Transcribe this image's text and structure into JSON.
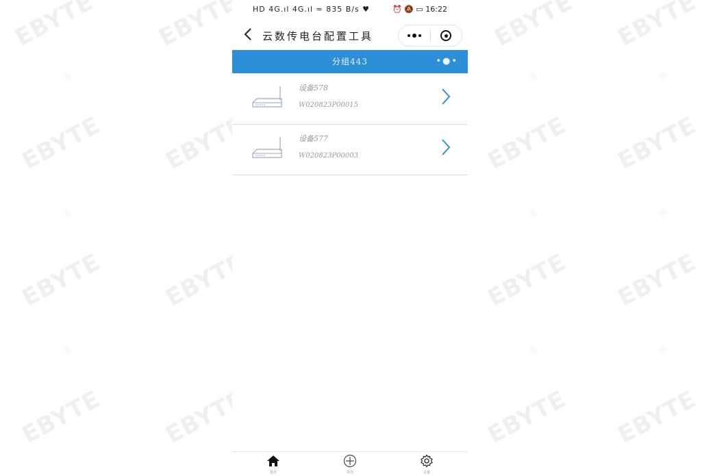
{
  "statusbar": {
    "left_text": "HD 4G.ıl 4G.ıl ≈ 835 B/s ♥",
    "right_text": "⏰ 🔕 ▭ 16:22"
  },
  "navbar": {
    "title": "云数传电台配置工具",
    "back_icon": "chevron-left-icon",
    "more_icon": "more-dots-icon",
    "close_icon": "target-close-icon"
  },
  "group": {
    "title": "分组443",
    "menu_label": "•●•"
  },
  "devices": [
    {
      "name": "设备578",
      "serial": "W020823P00015"
    },
    {
      "name": "设备577",
      "serial": "W020823P00003"
    }
  ],
  "tabbar": {
    "items": [
      {
        "label": "首页",
        "icon": "home-icon"
      },
      {
        "label": "添加",
        "icon": "plus-circle-icon"
      },
      {
        "label": "设置",
        "icon": "gear-icon"
      }
    ]
  },
  "watermark": {
    "logo_text": "EBYTE",
    "registered_mark": "®"
  },
  "colors": {
    "group_bar": "#2d8fd8",
    "chevron": "#2d8fd8",
    "watermark": "#888888"
  }
}
